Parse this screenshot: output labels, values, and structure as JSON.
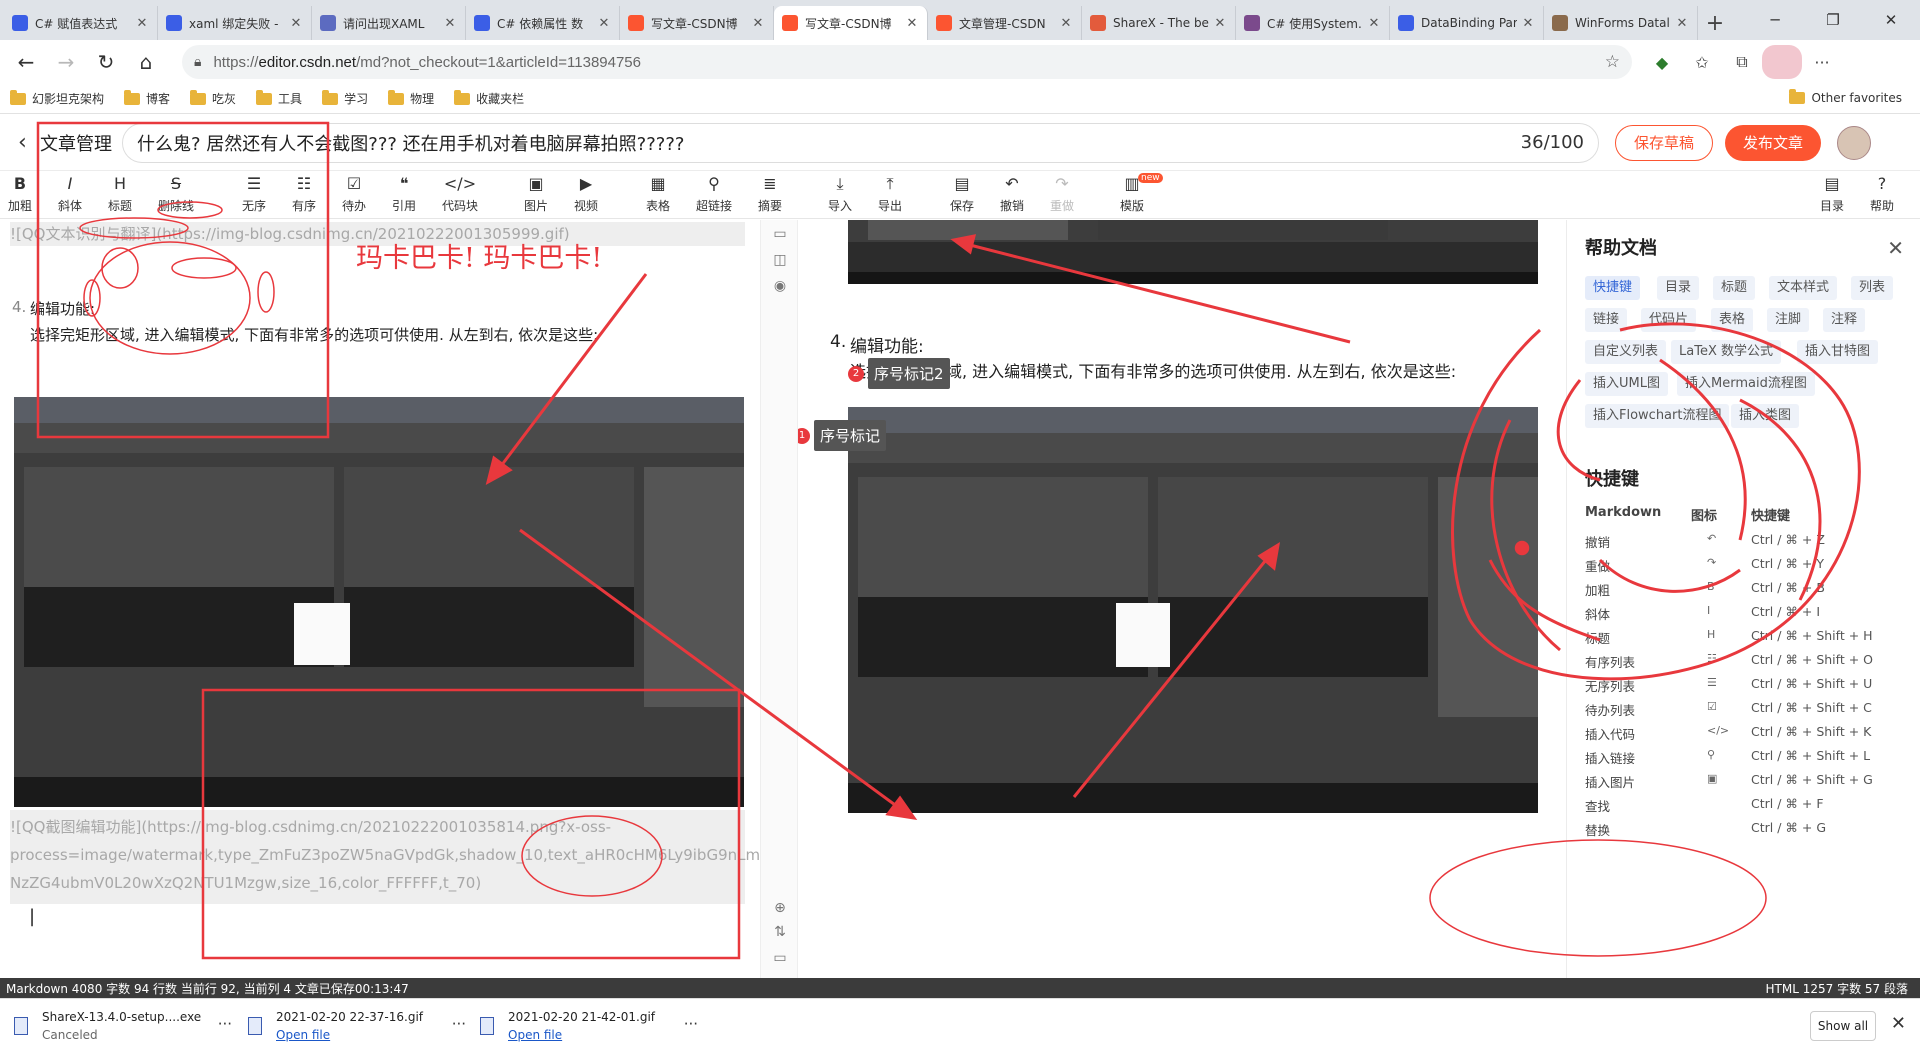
{
  "browser": {
    "tabs": [
      {
        "title": "C# 赋值表达式",
        "color": "#3b5ee6",
        "active": false
      },
      {
        "title": "xaml 绑定失败 -",
        "color": "#3b5ee6",
        "active": false
      },
      {
        "title": "请问出现XAML",
        "color": "#5c6bc0",
        "active": false
      },
      {
        "title": "C# 依赖属性 数",
        "color": "#3b5ee6",
        "active": false
      },
      {
        "title": "写文章-CSDN博",
        "color": "#fc5531",
        "active": false
      },
      {
        "title": "写文章-CSDN博",
        "color": "#fc5531",
        "active": true
      },
      {
        "title": "文章管理-CSDN",
        "color": "#fc5531",
        "active": false
      },
      {
        "title": "ShareX - The be",
        "color": "#e35b3c",
        "active": false
      },
      {
        "title": "C# 使用System.",
        "color": "#7b4a8c",
        "active": false
      },
      {
        "title": "DataBinding Par",
        "color": "#3b5ee6",
        "active": false
      },
      {
        "title": "WinForms Datal",
        "color": "#8a6a4c",
        "active": false
      }
    ],
    "url_prefix": "https://",
    "url_host": "editor.csdn.net",
    "url_path": "/md?not_checkout=1&articleId=113894756",
    "bookmarks": [
      "幻影坦克架构",
      "博客",
      "吃灰",
      "工具",
      "学习",
      "物理",
      "收藏夹栏"
    ],
    "other_favorites": "Other favorites"
  },
  "editor": {
    "back_label": "文章管理",
    "title": "什么鬼? 居然还有人不会截图??? 还在用手机对着电脑屏幕拍照?????",
    "title_count": "36/100",
    "save_draft": "保存草稿",
    "publish": "发布文章",
    "toolbar": [
      {
        "icon": "B",
        "label": "加粗"
      },
      {
        "icon": "I",
        "label": "斜体"
      },
      {
        "icon": "H",
        "label": "标题"
      },
      {
        "icon": "S",
        "label": "删除线"
      },
      {
        "icon": "☰",
        "label": "无序"
      },
      {
        "icon": "☷",
        "label": "有序"
      },
      {
        "icon": "☑",
        "label": "待办"
      },
      {
        "icon": "❝",
        "label": "引用"
      },
      {
        "icon": "</>",
        "label": "代码块"
      },
      {
        "icon": "▣",
        "label": "图片"
      },
      {
        "icon": "▶",
        "label": "视频"
      },
      {
        "icon": "▦",
        "label": "表格"
      },
      {
        "icon": "⚲",
        "label": "超链接"
      },
      {
        "icon": "≣",
        "label": "摘要"
      },
      {
        "icon": "⤓",
        "label": "导入"
      },
      {
        "icon": "⤒",
        "label": "导出"
      },
      {
        "icon": "▤",
        "label": "保存"
      },
      {
        "icon": "↶",
        "label": "撤销"
      },
      {
        "icon": "↷",
        "label": "重做"
      },
      {
        "icon": "▥",
        "label": "模版"
      },
      {
        "icon": "▤",
        "label": "目录"
      },
      {
        "icon": "?",
        "label": "帮助"
      }
    ],
    "new_badge": "new",
    "source": {
      "line_gif": "![QQ文本识别与翻译](https://img-blog.csdnimg.cn/20210222001305999.gif)",
      "list_num": "4.",
      "heading": "编辑功能:",
      "body": "选择完矩形区域, 进入编辑模式, 下面有非常多的选项可供使用. 从左到右, 依次是这些:",
      "img_line1": "![QQ截图编辑功能](https://img-blog.csdnimg.cn/20210222001035814.png?x-oss-",
      "img_line2": "process=image/watermark,type_ZmFuZ3poZW5naGVpdGk,shadow_10,text_aHR0cHM6Ly9ibG9nLm",
      "img_line3": "NzZG4ubmV0L20wXzQ2NTU1Mzgw,size_16,color_FFFFFF,t_70)",
      "cursor": "|"
    },
    "preview": {
      "list_num": "4.",
      "heading": "编辑功能:",
      "body": "选择完矩形区域, 进入编辑模式, 下面有非常多的选项可供使用. 从左到右, 依次是这些:",
      "marker1_num": "1",
      "marker1_label": "序号标记",
      "marker2_num": "2",
      "marker2_label": "序号标记2"
    },
    "annotation_text": "玛卡巴卡! 玛卡巴卡!"
  },
  "help": {
    "title": "帮助文档",
    "chips": [
      "快捷键",
      "目录",
      "标题",
      "文本样式",
      "列表",
      "链接",
      "代码片",
      "表格",
      "注脚",
      "注释",
      "自定义列表",
      "LaTeX 数学公式",
      "插入甘特图",
      "插入UML图",
      "插入Mermaid流程图",
      "插入Flowchart流程图",
      "插入类图"
    ],
    "shortcut_title": "快捷键",
    "col_markdown": "Markdown",
    "col_icon": "图标",
    "col_key": "快捷键",
    "shortcuts": [
      {
        "name": "撤销",
        "icon": "↶",
        "key": "Ctrl / ⌘ + Z"
      },
      {
        "name": "重做",
        "icon": "↷",
        "key": "Ctrl / ⌘ + Y"
      },
      {
        "name": "加粗",
        "icon": "B",
        "key": "Ctrl / ⌘ + B"
      },
      {
        "name": "斜体",
        "icon": "I",
        "key": "Ctrl / ⌘ + I"
      },
      {
        "name": "标题",
        "icon": "H",
        "key": "Ctrl / ⌘ + Shift + H"
      },
      {
        "name": "有序列表",
        "icon": "☷",
        "key": "Ctrl / ⌘ + Shift + O"
      },
      {
        "name": "无序列表",
        "icon": "☰",
        "key": "Ctrl / ⌘ + Shift + U"
      },
      {
        "name": "待办列表",
        "icon": "☑",
        "key": "Ctrl / ⌘ + Shift + C"
      },
      {
        "name": "插入代码",
        "icon": "</>",
        "key": "Ctrl / ⌘ + Shift + K"
      },
      {
        "name": "插入链接",
        "icon": "⚲",
        "key": "Ctrl / ⌘ + Shift + L"
      },
      {
        "name": "插入图片",
        "icon": "▣",
        "key": "Ctrl / ⌘ + Shift + G"
      },
      {
        "name": "查找",
        "icon": "",
        "key": "Ctrl / ⌘ + F"
      },
      {
        "name": "替换",
        "icon": "",
        "key": "Ctrl / ⌘ + G"
      }
    ]
  },
  "status": {
    "left": "Markdown  4080 字数  94 行数  当前行 92, 当前列 4  文章已保存00:13:47",
    "right": "HTML  1257 字数  57 段落"
  },
  "downloads": [
    {
      "name": "ShareX-13.4.0-setup....exe",
      "status": "Canceled",
      "link": false
    },
    {
      "name": "2021-02-20 22-37-16.gif",
      "status": "Open file",
      "link": true
    },
    {
      "name": "2021-02-20 21-42-01.gif",
      "status": "Open file",
      "link": true
    }
  ],
  "show_all": "Show all",
  "colors": {
    "brand": "#fc5531",
    "annotation": "#e8383d",
    "status_bg": "#3b3b3b"
  }
}
